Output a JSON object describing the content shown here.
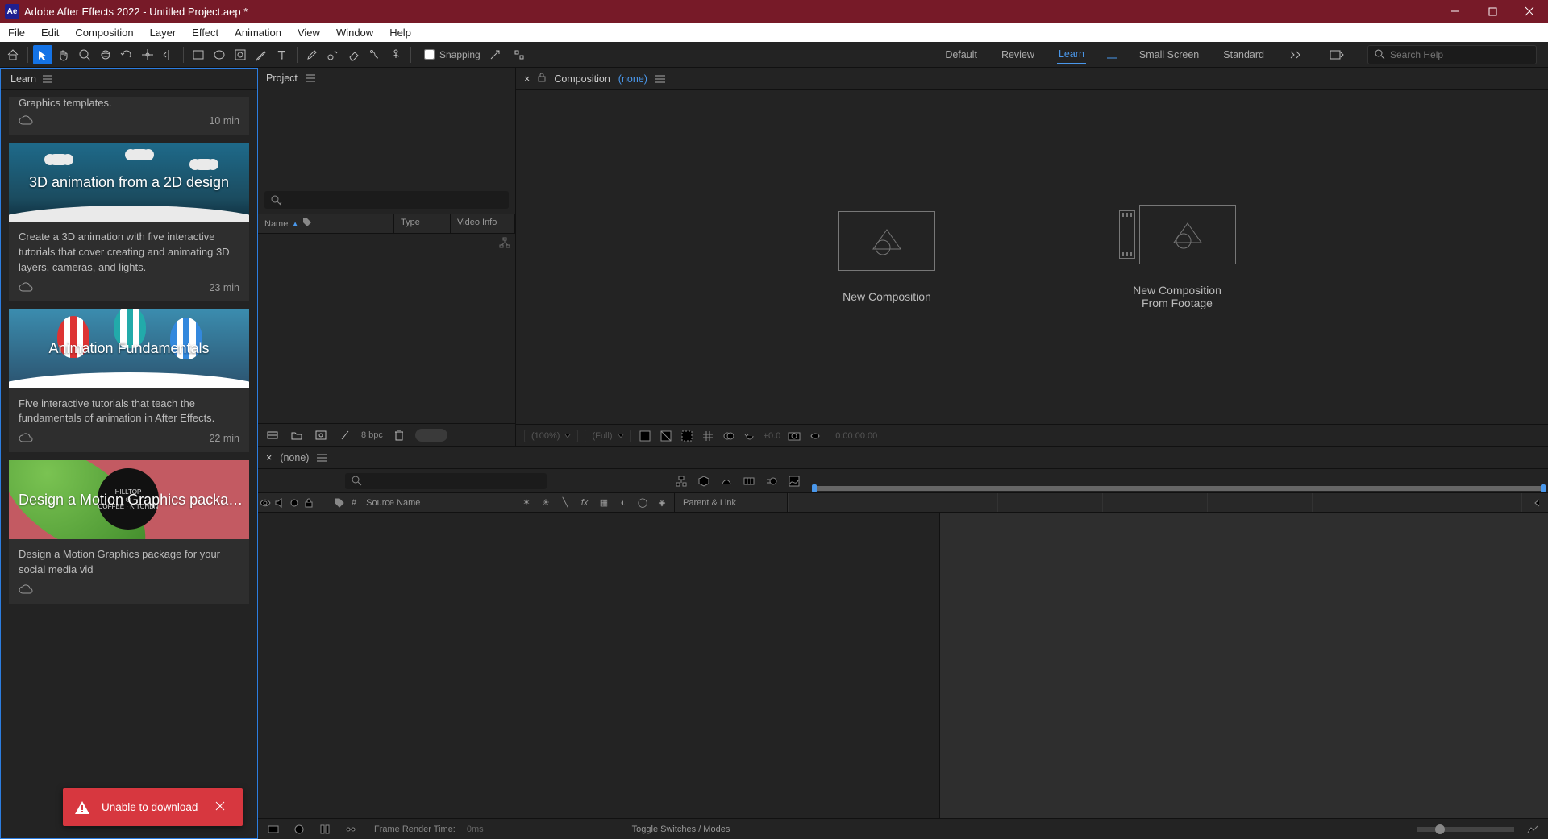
{
  "titlebar": {
    "title": "Adobe After Effects 2022 - Untitled Project.aep *",
    "logo": "Ae"
  },
  "menubar": [
    "File",
    "Edit",
    "Composition",
    "Layer",
    "Effect",
    "Animation",
    "View",
    "Window",
    "Help"
  ],
  "toolbar": {
    "snapping_label": "Snapping",
    "workspaces": [
      "Default",
      "Review",
      "Learn",
      "Small Screen",
      "Standard"
    ],
    "active_ws": "Learn",
    "search_placeholder": "Search Help"
  },
  "learn": {
    "tab": "Learn",
    "scroll_fragment": "Graphics templates.",
    "cards": [
      {
        "thumb_class": "t0",
        "title": "",
        "desc": "",
        "duration": "10 min"
      },
      {
        "thumb_class": "t1",
        "title": "3D animation from a 2D design",
        "desc": "Create a 3D animation with five interactive tutorials that cover creating and animating 3D layers, cameras, and lights.",
        "duration": "23 min"
      },
      {
        "thumb_class": "t2",
        "title": "Animation Fundamentals",
        "desc": "Five interactive tutorials that teach the fundamentals of animation in After Effects.",
        "duration": "22 min"
      },
      {
        "thumb_class": "t3",
        "title": "Design a Motion Graphics packa…",
        "desc": "Design a Motion Graphics package for your social media vid",
        "duration": ""
      }
    ],
    "toast": {
      "text": "Unable to download"
    }
  },
  "project": {
    "tab": "Project",
    "cols": {
      "name": "Name",
      "type": "Type",
      "video": "Video Info"
    },
    "bpc": "8 bpc"
  },
  "composition": {
    "tab": "Composition",
    "state": "(none)",
    "new_label": "New Composition",
    "from_footage_l1": "New Composition",
    "from_footage_l2": "From Footage",
    "zoom": "(100%)",
    "res": "(Full)",
    "expo": "+0.0",
    "timecode": "0:00:00:00"
  },
  "timeline": {
    "state": "(none)",
    "source": "Source Name",
    "parent": "Parent & Link",
    "hash": "#",
    "frt": "Frame Render Time:",
    "ms": "0ms",
    "switches": "Toggle Switches / Modes"
  }
}
